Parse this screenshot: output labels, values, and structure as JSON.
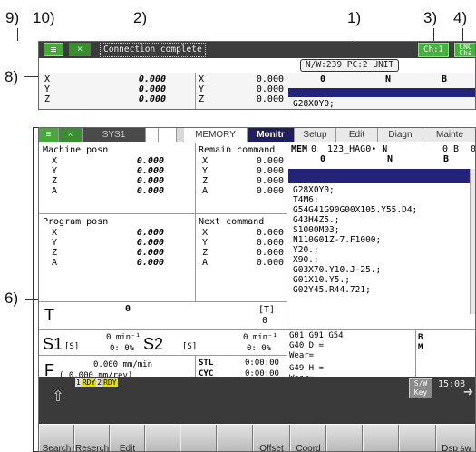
{
  "callouts": {
    "c9": "9)",
    "c10": "10)",
    "c2": "2)",
    "c1": "1)",
    "c3": "3)",
    "c4": "4)",
    "c8": "8)",
    "c6": "6)"
  },
  "top_panel": {
    "menu_icon": "≡",
    "close_icon": "×",
    "message": "Connection complete",
    "network_info": "N/W:239 PC:2 UNIT",
    "channel": "Ch:1",
    "cnc_change": "CNC Cha",
    "axes": [
      {
        "name": "X",
        "val": "0.000",
        "name2": "X",
        "val2": "0.000"
      },
      {
        "name": "Y",
        "val": "0.000",
        "name2": "Y",
        "val2": "0.000"
      },
      {
        "name": "Z",
        "val": "0.000",
        "name2": "Z",
        "val2": "0.000"
      }
    ],
    "right_row": {
      "a": "0",
      "b": "N",
      "c": "B"
    },
    "right_prog": "G28X0Y0;"
  },
  "tabs": {
    "sys": "SYS1",
    "memory": "MEMORY",
    "monitr": "Monitr",
    "setup": "Setup",
    "edit": "Edit",
    "diagn": "Diagn",
    "mainte": "Mainte"
  },
  "machine_posn": {
    "title": "Machine posn",
    "rows": [
      {
        "axis": "X",
        "val": "0.000"
      },
      {
        "axis": "Y",
        "val": "0.000"
      },
      {
        "axis": "Z",
        "val": "0.000"
      },
      {
        "axis": "A",
        "val": "0.000"
      }
    ]
  },
  "remain_command": {
    "title": "Remain command",
    "rows": [
      {
        "axis": "X",
        "val": "0.000"
      },
      {
        "axis": "Y",
        "val": "0.000"
      },
      {
        "axis": "Z",
        "val": "0.000"
      },
      {
        "axis": "A",
        "val": "0.000"
      }
    ]
  },
  "program_posn": {
    "title": "Program posn",
    "rows": [
      {
        "axis": "X",
        "val": "0.000"
      },
      {
        "axis": "Y",
        "val": "0.000"
      },
      {
        "axis": "Z",
        "val": "0.000"
      },
      {
        "axis": "A",
        "val": "0.000"
      }
    ]
  },
  "next_command": {
    "title": "Next command",
    "rows": [
      {
        "axis": "X",
        "val": "0.000"
      },
      {
        "axis": "Y",
        "val": "0.000"
      },
      {
        "axis": "Z",
        "val": "0.000"
      },
      {
        "axis": "A",
        "val": "0.000"
      }
    ]
  },
  "program": {
    "mode": "MEM",
    "line1": "0  123_HAG0• N",
    "line1b": "0 B",
    "line1c": "0",
    "line2a": "0",
    "line2b": "N",
    "line2c": "B",
    "lines": [
      "G28X0Y0;",
      "T4M6;",
      "G54G41G90G00X105.Y55.D4;",
      "G43H4Z5.;",
      "S1000M03;",
      "N110G01Z-7.F1000;",
      "Y20.;",
      "X90.;",
      "G03X70.Y10.J-25.;",
      "G01X10.Y5.;",
      "G02Y45.R44.721;"
    ]
  },
  "tool": {
    "label": "T",
    "value": "0",
    "bracket": "[T]",
    "bracket_val": "0"
  },
  "spindle": {
    "s1": "S1",
    "s1_unit": "[S]",
    "s1_rpm": "0 min⁻¹",
    "s1_pct": "0:   0%",
    "s2": "S2",
    "s2_unit": "[S]",
    "s2_rpm": "0 min⁻¹",
    "s2_pct": "0:   0%"
  },
  "feed": {
    "label": "F",
    "val1": "0.000 mm/min",
    "val2": "( 0.000   mm/rev)"
  },
  "timers": {
    "stl": "STL",
    "stl_val": "0:00:00",
    "cyc": "CYC",
    "cyc_val": "0:00:00"
  },
  "modal": {
    "l1": "G01   G91 G54",
    "l2": "G40   D   =",
    "l3": "      Wear=",
    "l4": "G49   H   =",
    "l5": "      Wear=",
    "b": "B",
    "m": "M"
  },
  "status": {
    "rdy1": "1",
    "rdy1_label": "RDY",
    "rdy2": "2",
    "rdy2_label": "RDY",
    "sw_key": "S/W Key",
    "time": "15:08"
  },
  "function_keys": [
    "Search",
    "Reserch",
    "Edit",
    "",
    "",
    "",
    "Offset",
    "Coord",
    "",
    "",
    "",
    "Dsp sw"
  ],
  "colors": {
    "green": "#45b23d",
    "navy": "#1f1f5e",
    "dark": "#3a3a3a"
  }
}
